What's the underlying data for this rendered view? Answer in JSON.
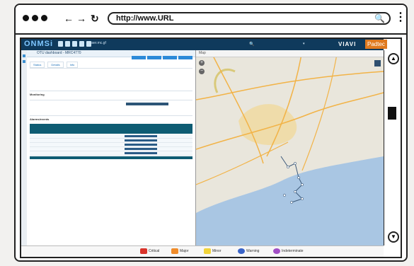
{
  "browser": {
    "url": "http://www.URL",
    "icons": [
      "back-arrow-icon",
      "forward-arrow-icon",
      "reload-icon",
      "search-icon",
      "kebab-menu-icon"
    ]
  },
  "app": {
    "logo": "ONMSi",
    "user": "ouser.mc.gf",
    "brand": "VIAVI",
    "partner": "Padtec"
  },
  "panel": {
    "title": "OTU dashboard - MRC4770",
    "tabs": [
      "Status",
      "Details",
      "Info"
    ],
    "sections": [
      "Monitoring",
      "Alarms/events"
    ]
  },
  "map": {
    "title": "Map",
    "zoom_in": "+",
    "zoom_out": "−"
  },
  "statusbar": [
    {
      "label": "Critical",
      "color": "#d9342b",
      "icon": "critical-icon"
    },
    {
      "label": "Major",
      "color": "#f08c2a",
      "icon": "major-icon"
    },
    {
      "label": "Minor",
      "color": "#f2d43a",
      "icon": "minor-icon"
    },
    {
      "label": "Warning",
      "color": "#3a64c8",
      "icon": "warning-icon"
    },
    {
      "label": "Indeterminate",
      "color": "#a24fc6",
      "icon": "indeterminate-icon"
    }
  ]
}
